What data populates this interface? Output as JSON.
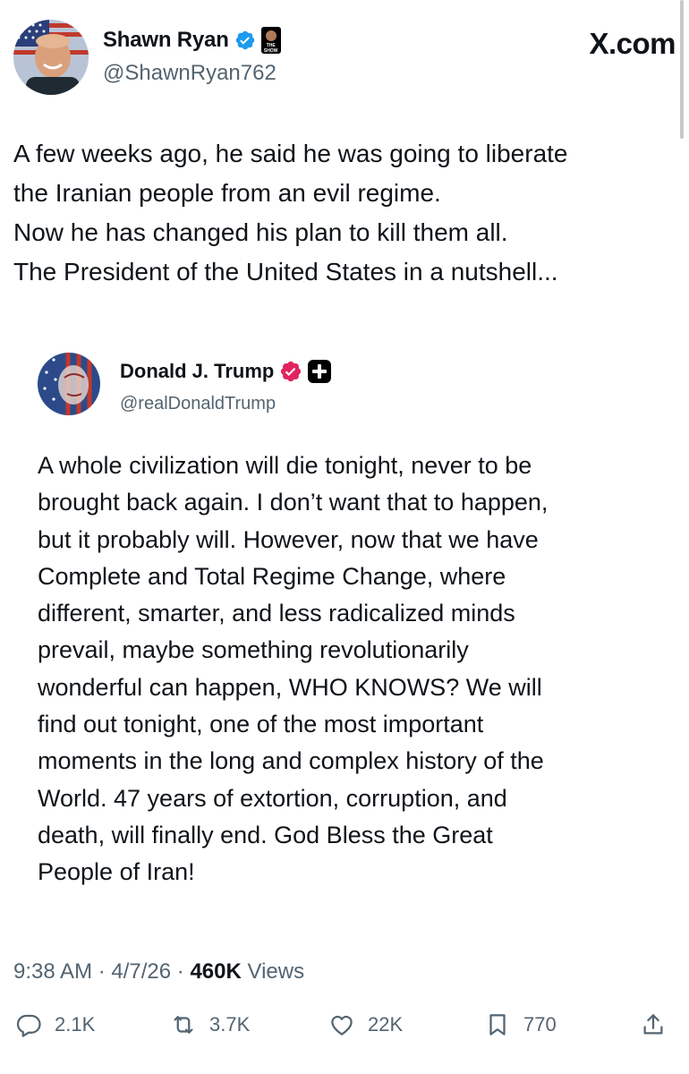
{
  "author": {
    "name": "Shawn Ryan",
    "handle": "@ShawnRyan762",
    "badge_text": "THE SHOW"
  },
  "site": {
    "label": "X.com"
  },
  "tweet_lines": [
    "A few weeks ago, he said he was going to liberate",
    "the Iranian people from an evil regime.",
    "Now he has changed his plan to kill them all.",
    "The President of the United States in a nutshell..."
  ],
  "quote": {
    "name": "Donald J. Trump",
    "handle": "@realDonaldTrump",
    "lines": [
      "A whole civilization will die tonight, never to be",
      "brought back again. I don’t want that to happen,",
      "but it probably will. However, now that we have",
      "Complete and Total Regime Change, where",
      "different, smarter, and less radicalized minds",
      "prevail, maybe something revolutionarily",
      "wonderful can happen, WHO KNOWS? We will",
      "find out tonight, one of the most important",
      "moments in the long and complex history of the",
      "World. 47 years of extortion, corruption, and",
      "death, will finally end. God Bless the Great",
      "People of Iran!"
    ]
  },
  "meta": {
    "time": "9:38 AM",
    "sep1": " · ",
    "date": "4/7/26",
    "sep2": " · ",
    "views_count": "460K",
    "views_label": " Views"
  },
  "actions": {
    "replies": "2.1K",
    "reposts": "3.7K",
    "likes": "22K",
    "bookmarks": "770"
  },
  "colors": {
    "verified_blue": "#1d9bf0",
    "verified_pink": "#e0245e",
    "text_primary": "#0f1419",
    "text_secondary": "#536471"
  },
  "icons": [
    "verified-badge-icon",
    "reply-icon",
    "repost-icon",
    "like-icon",
    "bookmark-icon",
    "share-icon"
  ]
}
